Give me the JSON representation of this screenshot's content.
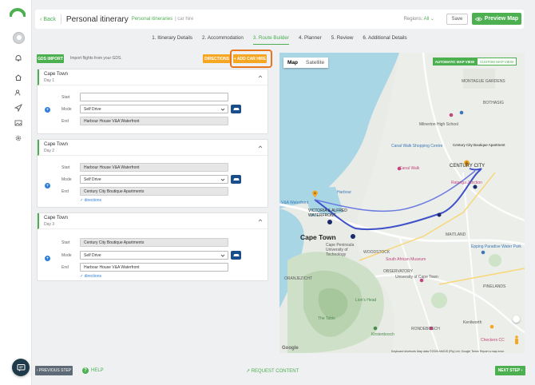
{
  "header": {
    "back_label": "Back",
    "title": "Personal itinerary",
    "crumb_primary": "Personal itineraries",
    "crumb_secondary": "car hire",
    "regions_label": "Regions:",
    "regions_value": "All",
    "save_label": "Save",
    "preview_label": "Preview Map"
  },
  "tabs": [
    {
      "label": "1. Itinerary Details",
      "active": false
    },
    {
      "label": "2. Accommodation",
      "active": false
    },
    {
      "label": "3. Route Builder",
      "active": true
    },
    {
      "label": "4. Planner",
      "active": false
    },
    {
      "label": "5. Review",
      "active": false
    },
    {
      "label": "6. Additional Details",
      "active": false
    }
  ],
  "toolbar": {
    "gds_label": "GDS IMPORT",
    "gds_hint": "Import flights from your GDS.",
    "directions_label": "DIRECTIONS",
    "add_car_label": "+ ADD CAR HIRE"
  },
  "days": [
    {
      "city": "Cape Town",
      "day": "Day 1",
      "start_label": "Start",
      "start": "",
      "mode_label": "Mode",
      "mode": "Self Drive",
      "end_label": "End",
      "end": "Harbour House V&A Waterfront",
      "directions": ""
    },
    {
      "city": "Cape Town",
      "day": "Day 2",
      "start_label": "Start",
      "start": "Harbour House V&A Waterfront",
      "mode_label": "Mode",
      "mode": "Self Drive",
      "end_label": "End",
      "end": "Century City Boutique Apartments",
      "directions": "directions"
    },
    {
      "city": "Cape Town",
      "day": "Day 3",
      "start_label": "Start",
      "start": "Century City Boutique Apartments",
      "mode_label": "Mode",
      "mode": "Self Drive",
      "end_label": "End",
      "end": "Harbour House V&A Waterfront",
      "directions": "directions"
    }
  ],
  "map": {
    "map_tab": "Map",
    "satellite_tab": "Satellite",
    "auto_view": "AUTOMATIC MAP VIEW",
    "custom_view": "CUSTOM MAP VIEW",
    "labels": {
      "cape_town": "Cape Town",
      "century_city": "CENTURY CITY",
      "century_apartments": "Century City Boutique Apartment",
      "victoria_wharf": "VICTORIA & ALFRED WATERFRONT",
      "va_waterfront": "V&A Waterfront",
      "woodstock": "WOODSTOCK",
      "observatory": "OBSERVATORY",
      "oranjezicht": "ORANJEZICHT",
      "maitland": "MAITLAND",
      "rondebosch": "RONDEBOSCH",
      "canal_walk": "Canal Walk",
      "ratanga": "Ratanga Junction",
      "milnerton": "Milnerton High School",
      "montague": "MONTAGUE GARDENS",
      "bothasig": "BOTHASIG",
      "canal_walk_2": "Canal Walk Shopping Centre",
      "spa": "Epping Paradise Water Park",
      "sa_museum": "South African Museum",
      "lions_head": "Lion's Head",
      "kirstenbosch": "Kirstenbosch",
      "pinelands": "PINELANDS",
      "uct": "University of Cape Town",
      "checkers": "Checkers CC",
      "kenilworth": "Kenilworth",
      "cape_peninsula_uni": "Cape Peninsula University of Technology",
      "harbour": "Harbour",
      "the_table": "The Table"
    },
    "pin_a": "A",
    "pin_b": "B",
    "google": "Google",
    "attribution": "Keyboard shortcuts  Map data ©2026 AfriGIS (Pty) Ltd, Google  Terms  Report a map error"
  },
  "footer": {
    "prev_label": "PREVIOUS STEP",
    "help_label": "HELP",
    "request_label": "REQUEST CONTENT",
    "next_label": "NEXT STEP"
  },
  "colors": {
    "accent": "#4caf50",
    "orange": "#f5a623",
    "route": "#3f51c8"
  }
}
